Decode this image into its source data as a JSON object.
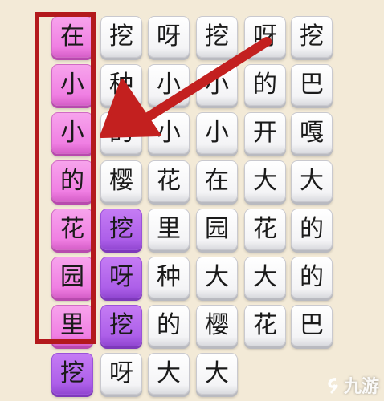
{
  "grid": {
    "rows": [
      [
        {
          "char": "在",
          "color": "pink"
        },
        {
          "char": "挖",
          "color": "white"
        },
        {
          "char": "呀",
          "color": "white"
        },
        {
          "char": "挖",
          "color": "white"
        },
        {
          "char": "呀",
          "color": "white"
        },
        {
          "char": "挖",
          "color": "white"
        }
      ],
      [
        {
          "char": "小",
          "color": "pink"
        },
        {
          "char": "种",
          "color": "white"
        },
        {
          "char": "小",
          "color": "white"
        },
        {
          "char": "小",
          "color": "white"
        },
        {
          "char": "的",
          "color": "white"
        },
        {
          "char": "巴",
          "color": "white"
        }
      ],
      [
        {
          "char": "小",
          "color": "pink"
        },
        {
          "char": "的",
          "color": "white"
        },
        {
          "char": "小",
          "color": "white"
        },
        {
          "char": "小",
          "color": "white"
        },
        {
          "char": "开",
          "color": "white"
        },
        {
          "char": "嘎",
          "color": "white"
        }
      ],
      [
        {
          "char": "的",
          "color": "pink"
        },
        {
          "char": "樱",
          "color": "white"
        },
        {
          "char": "花",
          "color": "white"
        },
        {
          "char": "在",
          "color": "white"
        },
        {
          "char": "大",
          "color": "white"
        },
        {
          "char": "大",
          "color": "white"
        }
      ],
      [
        {
          "char": "花",
          "color": "pink"
        },
        {
          "char": "挖",
          "color": "purple"
        },
        {
          "char": "里",
          "color": "white"
        },
        {
          "char": "园",
          "color": "white"
        },
        {
          "char": "花",
          "color": "white"
        },
        {
          "char": "的",
          "color": "white"
        }
      ],
      [
        {
          "char": "园",
          "color": "pink"
        },
        {
          "char": "呀",
          "color": "purple"
        },
        {
          "char": "种",
          "color": "white"
        },
        {
          "char": "大",
          "color": "white"
        },
        {
          "char": "大",
          "color": "white"
        },
        {
          "char": "的",
          "color": "white"
        }
      ],
      [
        {
          "char": "里",
          "color": "pink"
        },
        {
          "char": "挖",
          "color": "purple"
        },
        {
          "char": "的",
          "color": "white"
        },
        {
          "char": "樱",
          "color": "white"
        },
        {
          "char": "花",
          "color": "white"
        },
        {
          "char": "巴",
          "color": "white"
        }
      ],
      [
        {
          "char": "挖",
          "color": "purple"
        },
        {
          "char": "呀",
          "color": "white"
        },
        {
          "char": "大",
          "color": "white"
        },
        {
          "char": "大",
          "color": "white"
        },
        null,
        null
      ]
    ]
  },
  "colors": {
    "background": "#f3ead7",
    "pink": "#f07fe3",
    "purple": "#ad5fe9",
    "white": "#ffffff",
    "highlight": "#b3191c",
    "arrow": "#c3201f"
  },
  "watermark": {
    "icon": "jiuyou-logo-icon",
    "text": "九游"
  }
}
